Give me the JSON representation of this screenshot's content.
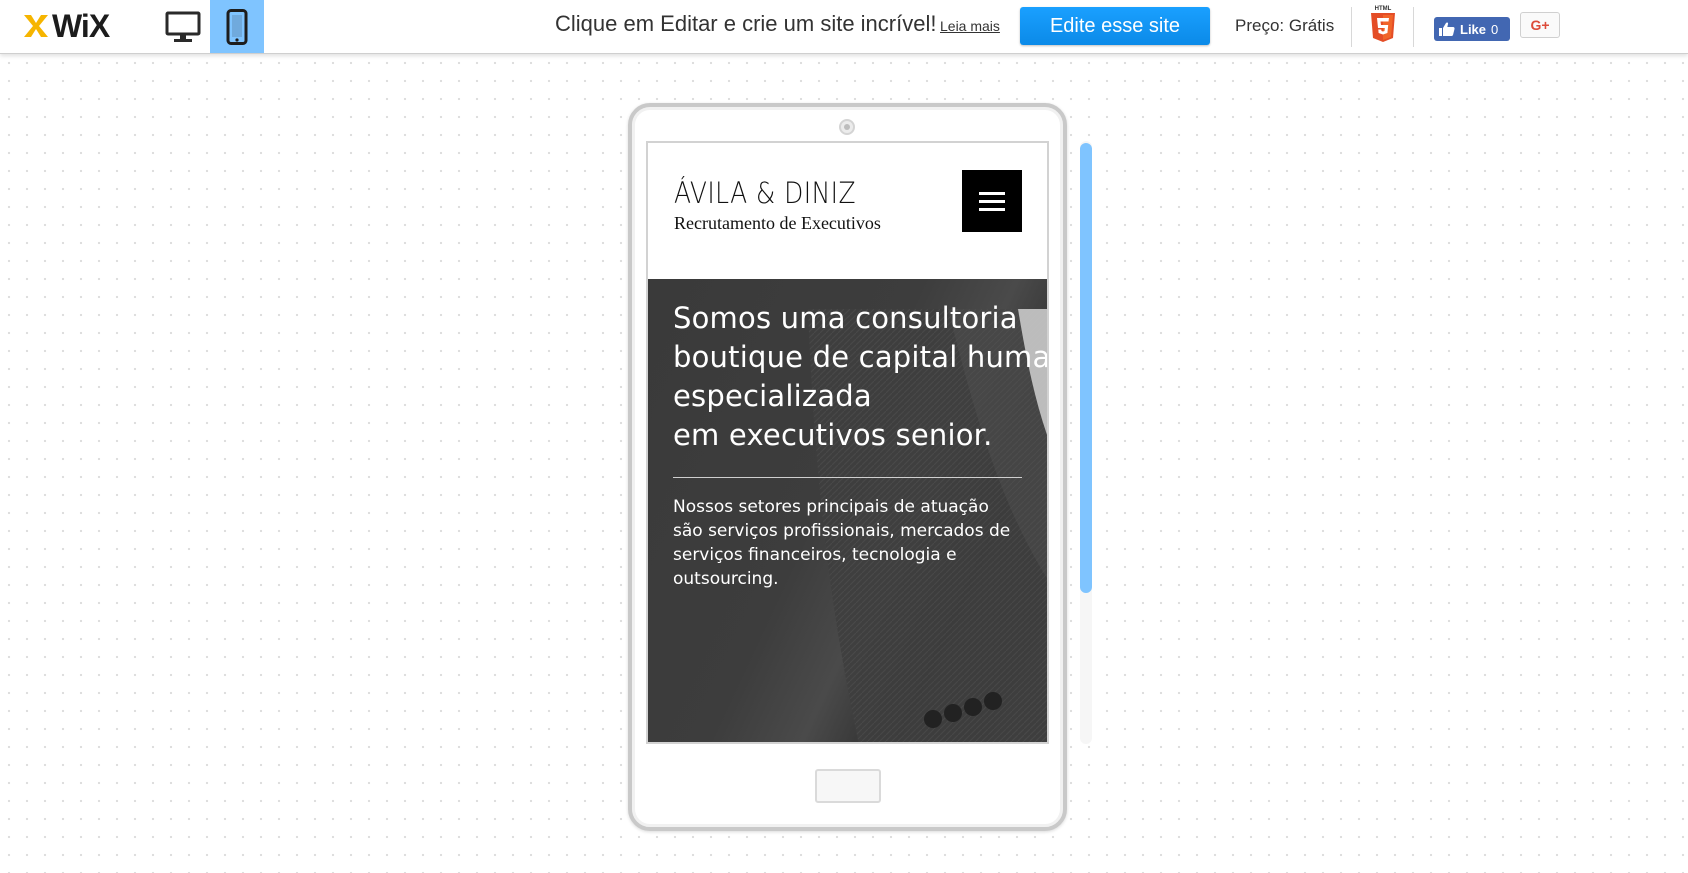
{
  "topbar": {
    "logo_text": "WiX",
    "device_buttons": [
      {
        "name": "desktop-icon",
        "active": false
      },
      {
        "name": "mobile-icon",
        "active": true
      }
    ],
    "promo_text": "Clique em Editar e crie um site incrível!",
    "read_more": "Leia mais",
    "edit_button": "Edite esse site",
    "price": "Preço: Grátis",
    "html5_label": "HTML",
    "fb_like_label": "Like",
    "fb_like_count": "0",
    "gplus_label": "G+"
  },
  "site": {
    "brand_name": "ÁVILA & DINIZ",
    "brand_subtitle": "Recrutamento de Executivos",
    "hero_title": "Somos uma consultoria\nboutique de capital humano\nespecializada\nem executivos senior.",
    "hero_text": "Nossos setores principais de atuação\nsão serviços profissionais, mercados de\nserviços financeiros, tecnologia e\noutsourcing."
  },
  "colors": {
    "accent_blue": "#7fc4ff",
    "edit_button": "#0b8ae8",
    "fb_blue": "#4267b2",
    "gplus_red": "#dd4b39",
    "hero_bg": "#3a3a3a"
  }
}
